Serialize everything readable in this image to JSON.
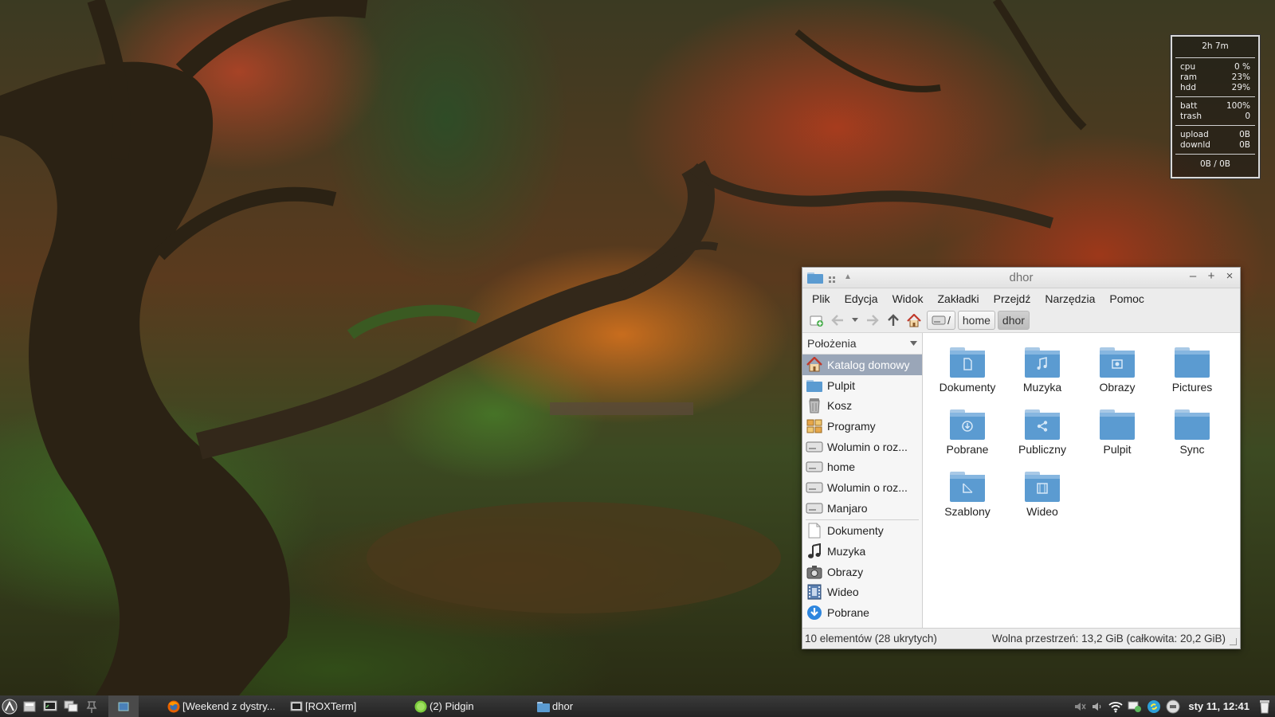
{
  "conky": {
    "uptime": "2h 7m",
    "cpu_label": "cpu",
    "cpu_value": "0 %",
    "ram_label": "ram",
    "ram_value": "23%",
    "hdd_label": "hdd",
    "hdd_value": "29%",
    "batt_label": "batt",
    "batt_value": "100%",
    "trash_label": "trash",
    "trash_value": "0",
    "upload_label": "upload",
    "upload_value": "0B",
    "downld_label": "downld",
    "downld_value": "0B",
    "totals": "0B   / 0B"
  },
  "window": {
    "title": "dhor",
    "menu": [
      "Plik",
      "Edycja",
      "Widok",
      "Zakładki",
      "Przejdź",
      "Narzędzia",
      "Pomoc"
    ],
    "path": [
      "/",
      "home",
      "dhor"
    ],
    "sidebar_header": "Położenia",
    "places": [
      {
        "label": "Katalog domowy",
        "icon": "home-icon",
        "selected": true
      },
      {
        "label": "Pulpit",
        "icon": "desktop-folder-icon"
      },
      {
        "label": "Kosz",
        "icon": "trash-icon"
      },
      {
        "label": "Programy",
        "icon": "applications-icon"
      },
      {
        "label": "Wolumin o roz...",
        "icon": "drive-icon"
      },
      {
        "label": "home",
        "icon": "drive-icon"
      },
      {
        "label": "Wolumin o roz...",
        "icon": "drive-icon"
      },
      {
        "label": "Manjaro",
        "icon": "drive-icon"
      }
    ],
    "bookmarks": [
      {
        "label": "Dokumenty",
        "icon": "document-icon"
      },
      {
        "label": "Muzyka",
        "icon": "music-icon"
      },
      {
        "label": "Obrazy",
        "icon": "pictures-icon"
      },
      {
        "label": "Wideo",
        "icon": "video-icon"
      },
      {
        "label": "Pobrane",
        "icon": "download-icon"
      }
    ],
    "files": [
      {
        "label": "Dokumenty",
        "emblem": "document"
      },
      {
        "label": "Muzyka",
        "emblem": "music"
      },
      {
        "label": "Obrazy",
        "emblem": "pictures"
      },
      {
        "label": "Pictures",
        "emblem": "none"
      },
      {
        "label": "Pobrane",
        "emblem": "download"
      },
      {
        "label": "Publiczny",
        "emblem": "share"
      },
      {
        "label": "Pulpit",
        "emblem": "none"
      },
      {
        "label": "Sync",
        "emblem": "none"
      },
      {
        "label": "Szablony",
        "emblem": "template"
      },
      {
        "label": "Wideo",
        "emblem": "video"
      }
    ],
    "status_left": "10 elementów (28 ukrytych)",
    "status_right": "Wolna przestrzeń: 13,2 GiB (całkowita: 20,2 GiB)"
  },
  "taskbar": {
    "tasks": [
      {
        "label": "[Weekend z dystry...",
        "icon": "firefox-icon"
      },
      {
        "label": "[ROXTerm]",
        "icon": "terminal-icon"
      },
      {
        "label": "(2) Pidgin",
        "icon": "pidgin-icon"
      },
      {
        "label": "dhor",
        "icon": "folder-icon"
      }
    ],
    "clock": "sty 11, 12:41"
  },
  "colors": {
    "folder_top": "#a9c9e6",
    "folder_body": "#5b9bd1",
    "selection": "#9aa6b8"
  }
}
